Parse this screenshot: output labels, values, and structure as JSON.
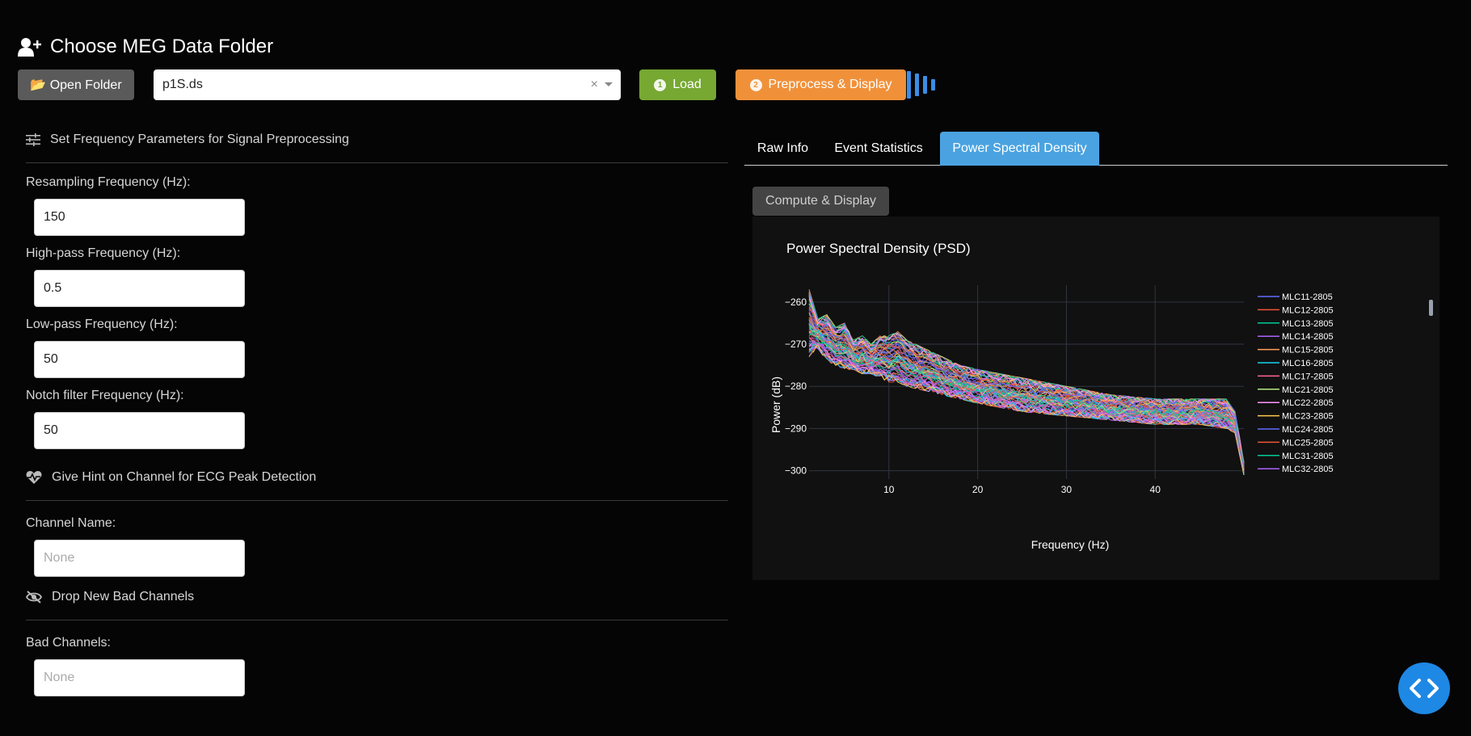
{
  "header": {
    "title": "Choose MEG Data Folder",
    "icon": "add-user-icon"
  },
  "toolbar": {
    "open_label": "📂 Open Folder",
    "folder_value": "p1S.ds",
    "clear_symbol": "×",
    "load_label": "Load",
    "load_number": "1",
    "preprocess_label": "Preprocess & Display",
    "preprocess_number": "2",
    "colors": {
      "load": "#76a832",
      "preprocess": "#f0913a",
      "open": "#5a5a5a",
      "spinner": "#3a8ee6"
    }
  },
  "freq_section": {
    "title": "Set Frequency Parameters for Signal Preprocessing",
    "icon": "sliders-icon",
    "fields": [
      {
        "label": "Resampling Frequency (Hz):",
        "value": "150"
      },
      {
        "label": "High-pass Frequency (Hz):",
        "value": "0.5"
      },
      {
        "label": "Low-pass Frequency (Hz):",
        "value": "50"
      },
      {
        "label": "Notch filter Frequency (Hz):",
        "value": "50"
      }
    ]
  },
  "ecg_section": {
    "title": "Give Hint on Channel for ECG Peak Detection",
    "icon": "heartbeat-icon",
    "field_label": "Channel Name:",
    "placeholder": "None"
  },
  "bad_section": {
    "title": "Drop New Bad Channels",
    "icon": "eye-slash-icon",
    "field_label": "Bad Channels:",
    "placeholder": "None"
  },
  "tabs": [
    {
      "label": "Raw Info",
      "active": false
    },
    {
      "label": "Event Statistics",
      "active": false
    },
    {
      "label": "Power Spectral Density",
      "active": true
    }
  ],
  "compute_label": "Compute & Display",
  "chart_data": {
    "type": "line",
    "title": "Power Spectral Density (PSD)",
    "xlabel": "Frequency (Hz)",
    "ylabel": "Power (dB)",
    "xlim": [
      1,
      50
    ],
    "ylim": [
      -302,
      -256
    ],
    "x_ticks": [
      10,
      20,
      30,
      40
    ],
    "y_ticks": [
      -260,
      -270,
      -280,
      -290,
      -300
    ],
    "grid": true,
    "legend_position": "right",
    "series": [
      {
        "name": "MLC11-2805",
        "color": "#636efa"
      },
      {
        "name": "MLC12-2805",
        "color": "#ef553b"
      },
      {
        "name": "MLC13-2805",
        "color": "#00cc96"
      },
      {
        "name": "MLC14-2805",
        "color": "#ab63fa"
      },
      {
        "name": "MLC15-2805",
        "color": "#ffa15a"
      },
      {
        "name": "MLC16-2805",
        "color": "#19d3f3"
      },
      {
        "name": "MLC17-2805",
        "color": "#ff6692"
      },
      {
        "name": "MLC21-2805",
        "color": "#b6e880"
      },
      {
        "name": "MLC22-2805",
        "color": "#ff97ff"
      },
      {
        "name": "MLC23-2805",
        "color": "#fecb52"
      },
      {
        "name": "MLC24-2805",
        "color": "#636efa"
      },
      {
        "name": "MLC25-2805",
        "color": "#ef553b"
      },
      {
        "name": "MLC31-2805",
        "color": "#00cc96"
      },
      {
        "name": "MLC32-2805",
        "color": "#ab63fa"
      }
    ],
    "envelope": {
      "x": [
        1,
        2,
        3,
        4,
        5,
        6,
        7,
        8,
        9,
        10,
        11,
        12,
        14,
        16,
        18,
        20,
        25,
        30,
        35,
        40,
        45,
        48,
        49,
        50
      ],
      "upper": [
        -257,
        -264,
        -263,
        -266,
        -265,
        -269,
        -268,
        -270,
        -268,
        -268,
        -267,
        -269,
        -271,
        -273,
        -275,
        -276,
        -278,
        -280,
        -282,
        -283,
        -283,
        -283,
        -286,
        -298
      ],
      "lower": [
        -273,
        -271,
        -274,
        -275,
        -276,
        -276,
        -277,
        -277,
        -278,
        -279,
        -279,
        -280,
        -281,
        -282,
        -283,
        -284,
        -286,
        -287,
        -288,
        -289,
        -289,
        -290,
        -291,
        -301
      ]
    }
  }
}
